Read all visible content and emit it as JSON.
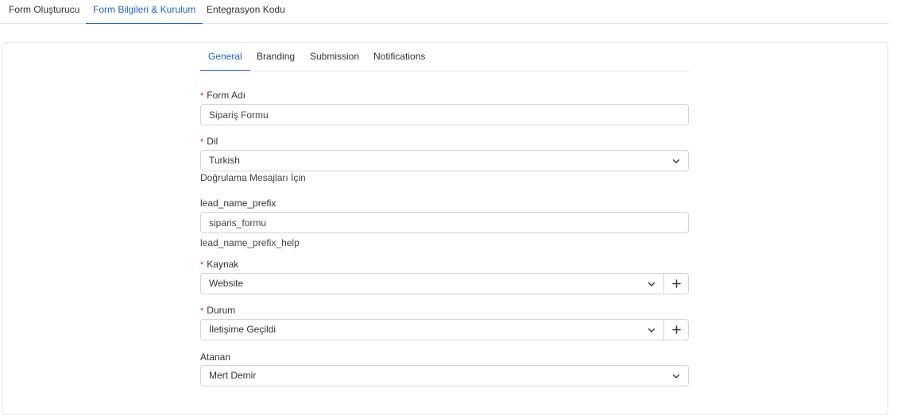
{
  "top_tabs": [
    {
      "label": "Form Oluşturucu"
    },
    {
      "label": "Form Bilgileri & Kurulum"
    },
    {
      "label": "Entegrasyon Kodu"
    }
  ],
  "inner_tabs": [
    {
      "label": "General"
    },
    {
      "label": "Branding"
    },
    {
      "label": "Submission"
    },
    {
      "label": "Notifications"
    }
  ],
  "form": {
    "form_name": {
      "label": "Form Adı",
      "value": "Sipariş Formu"
    },
    "language": {
      "label": "Dil",
      "value": "Turkish",
      "help": "Doğrulama Mesajları İçin"
    },
    "lead_prefix": {
      "label": "lead_name_prefix",
      "value": "siparis_formu",
      "help": "lead_name_prefix_help"
    },
    "source": {
      "label": "Kaynak",
      "value": "Website"
    },
    "status": {
      "label": "Durum",
      "value": "İletişime Geçildi"
    },
    "assignee": {
      "label": "Atanan",
      "value": "Mert Demir"
    }
  },
  "required_mark": "*",
  "colors": {
    "accent": "#2563c7",
    "required": "#dc2626",
    "border": "#d1d5db"
  },
  "icons": {
    "dropdown": "chevron-down-icon",
    "add": "plus-icon"
  }
}
